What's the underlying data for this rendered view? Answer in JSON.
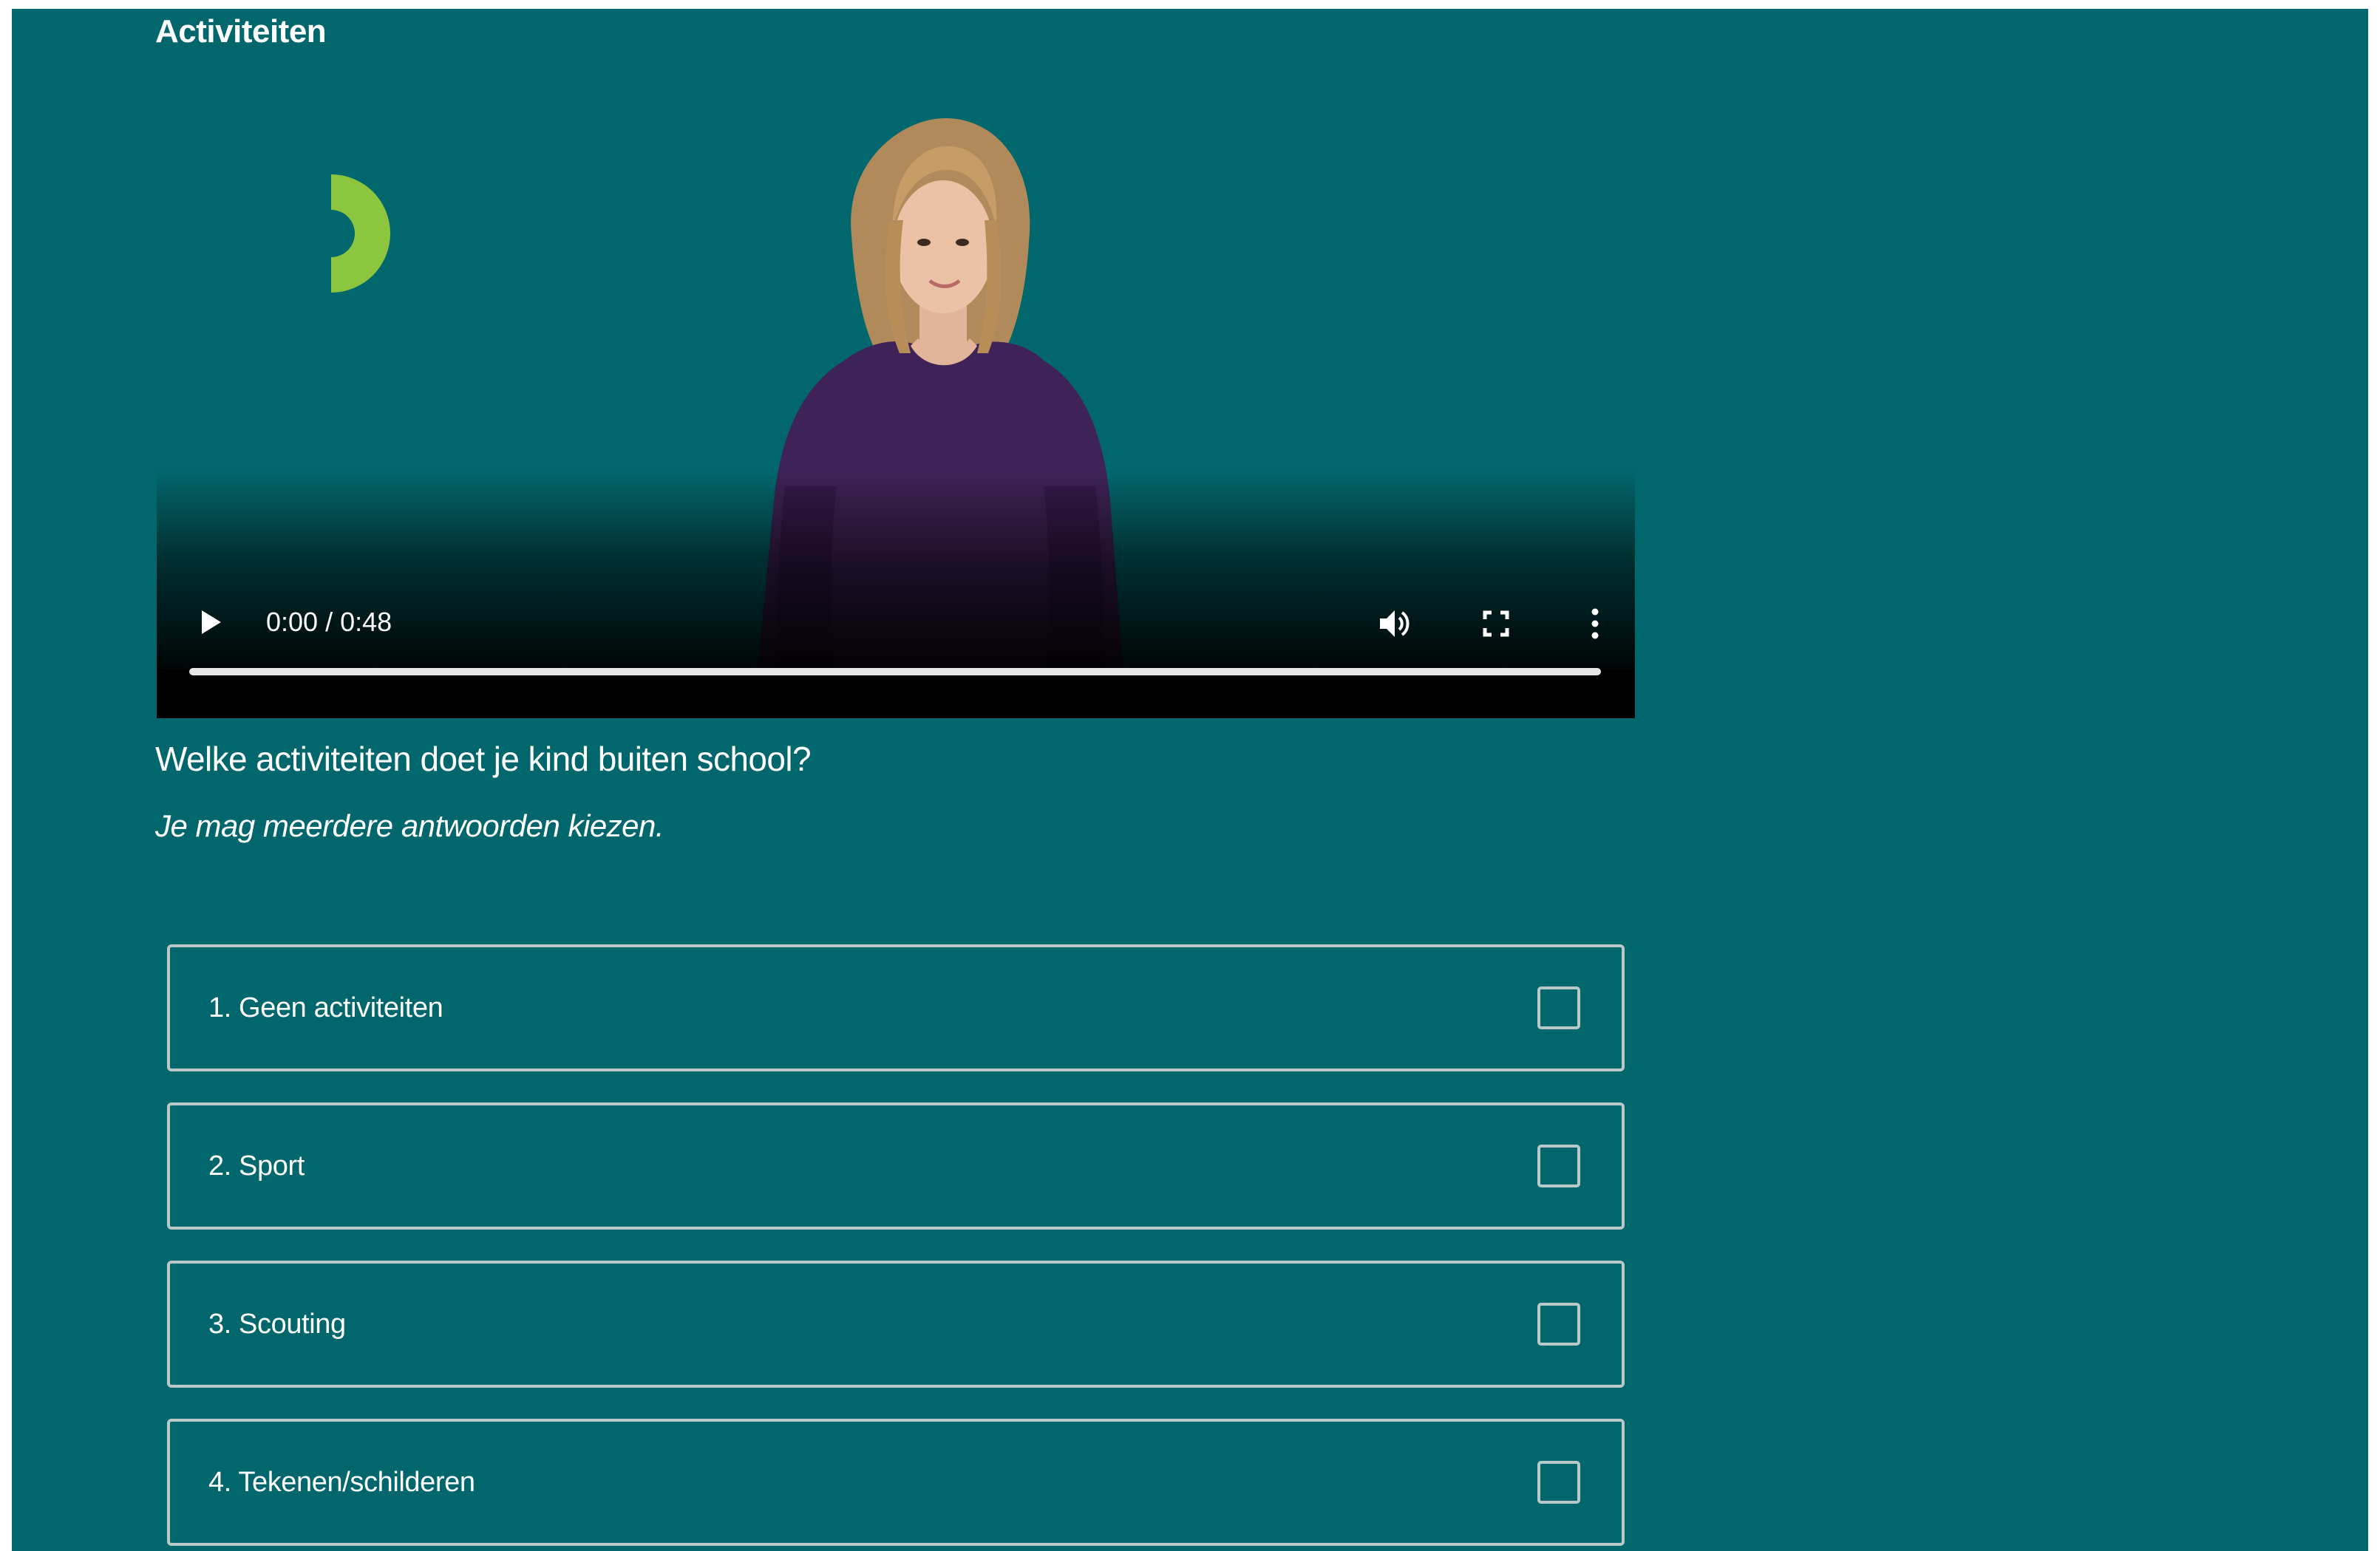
{
  "section": {
    "title": "Activiteiten"
  },
  "video": {
    "time_display": "0:00 / 0:48",
    "progress": 0,
    "icons": {
      "play": "play-icon",
      "volume": "volume-icon",
      "fullscreen": "fullscreen-icon",
      "more": "more-options-icon",
      "logo": "logo-mark"
    },
    "colors": {
      "logo": "#8cc63f",
      "shirt": "#3f2257"
    }
  },
  "question": {
    "text": "Welke activiteiten doet je kind buiten school?",
    "hint": "Je mag meerdere antwoorden kiezen."
  },
  "options": [
    {
      "label": "1. Geen activiteiten",
      "checked": false
    },
    {
      "label": "2. Sport",
      "checked": false
    },
    {
      "label": "3. Scouting",
      "checked": false
    },
    {
      "label": "4. Tekenen/schilderen",
      "checked": false
    }
  ],
  "colors": {
    "background": "#01676c",
    "border": "#b9c9ca",
    "text": "#ffffff"
  }
}
